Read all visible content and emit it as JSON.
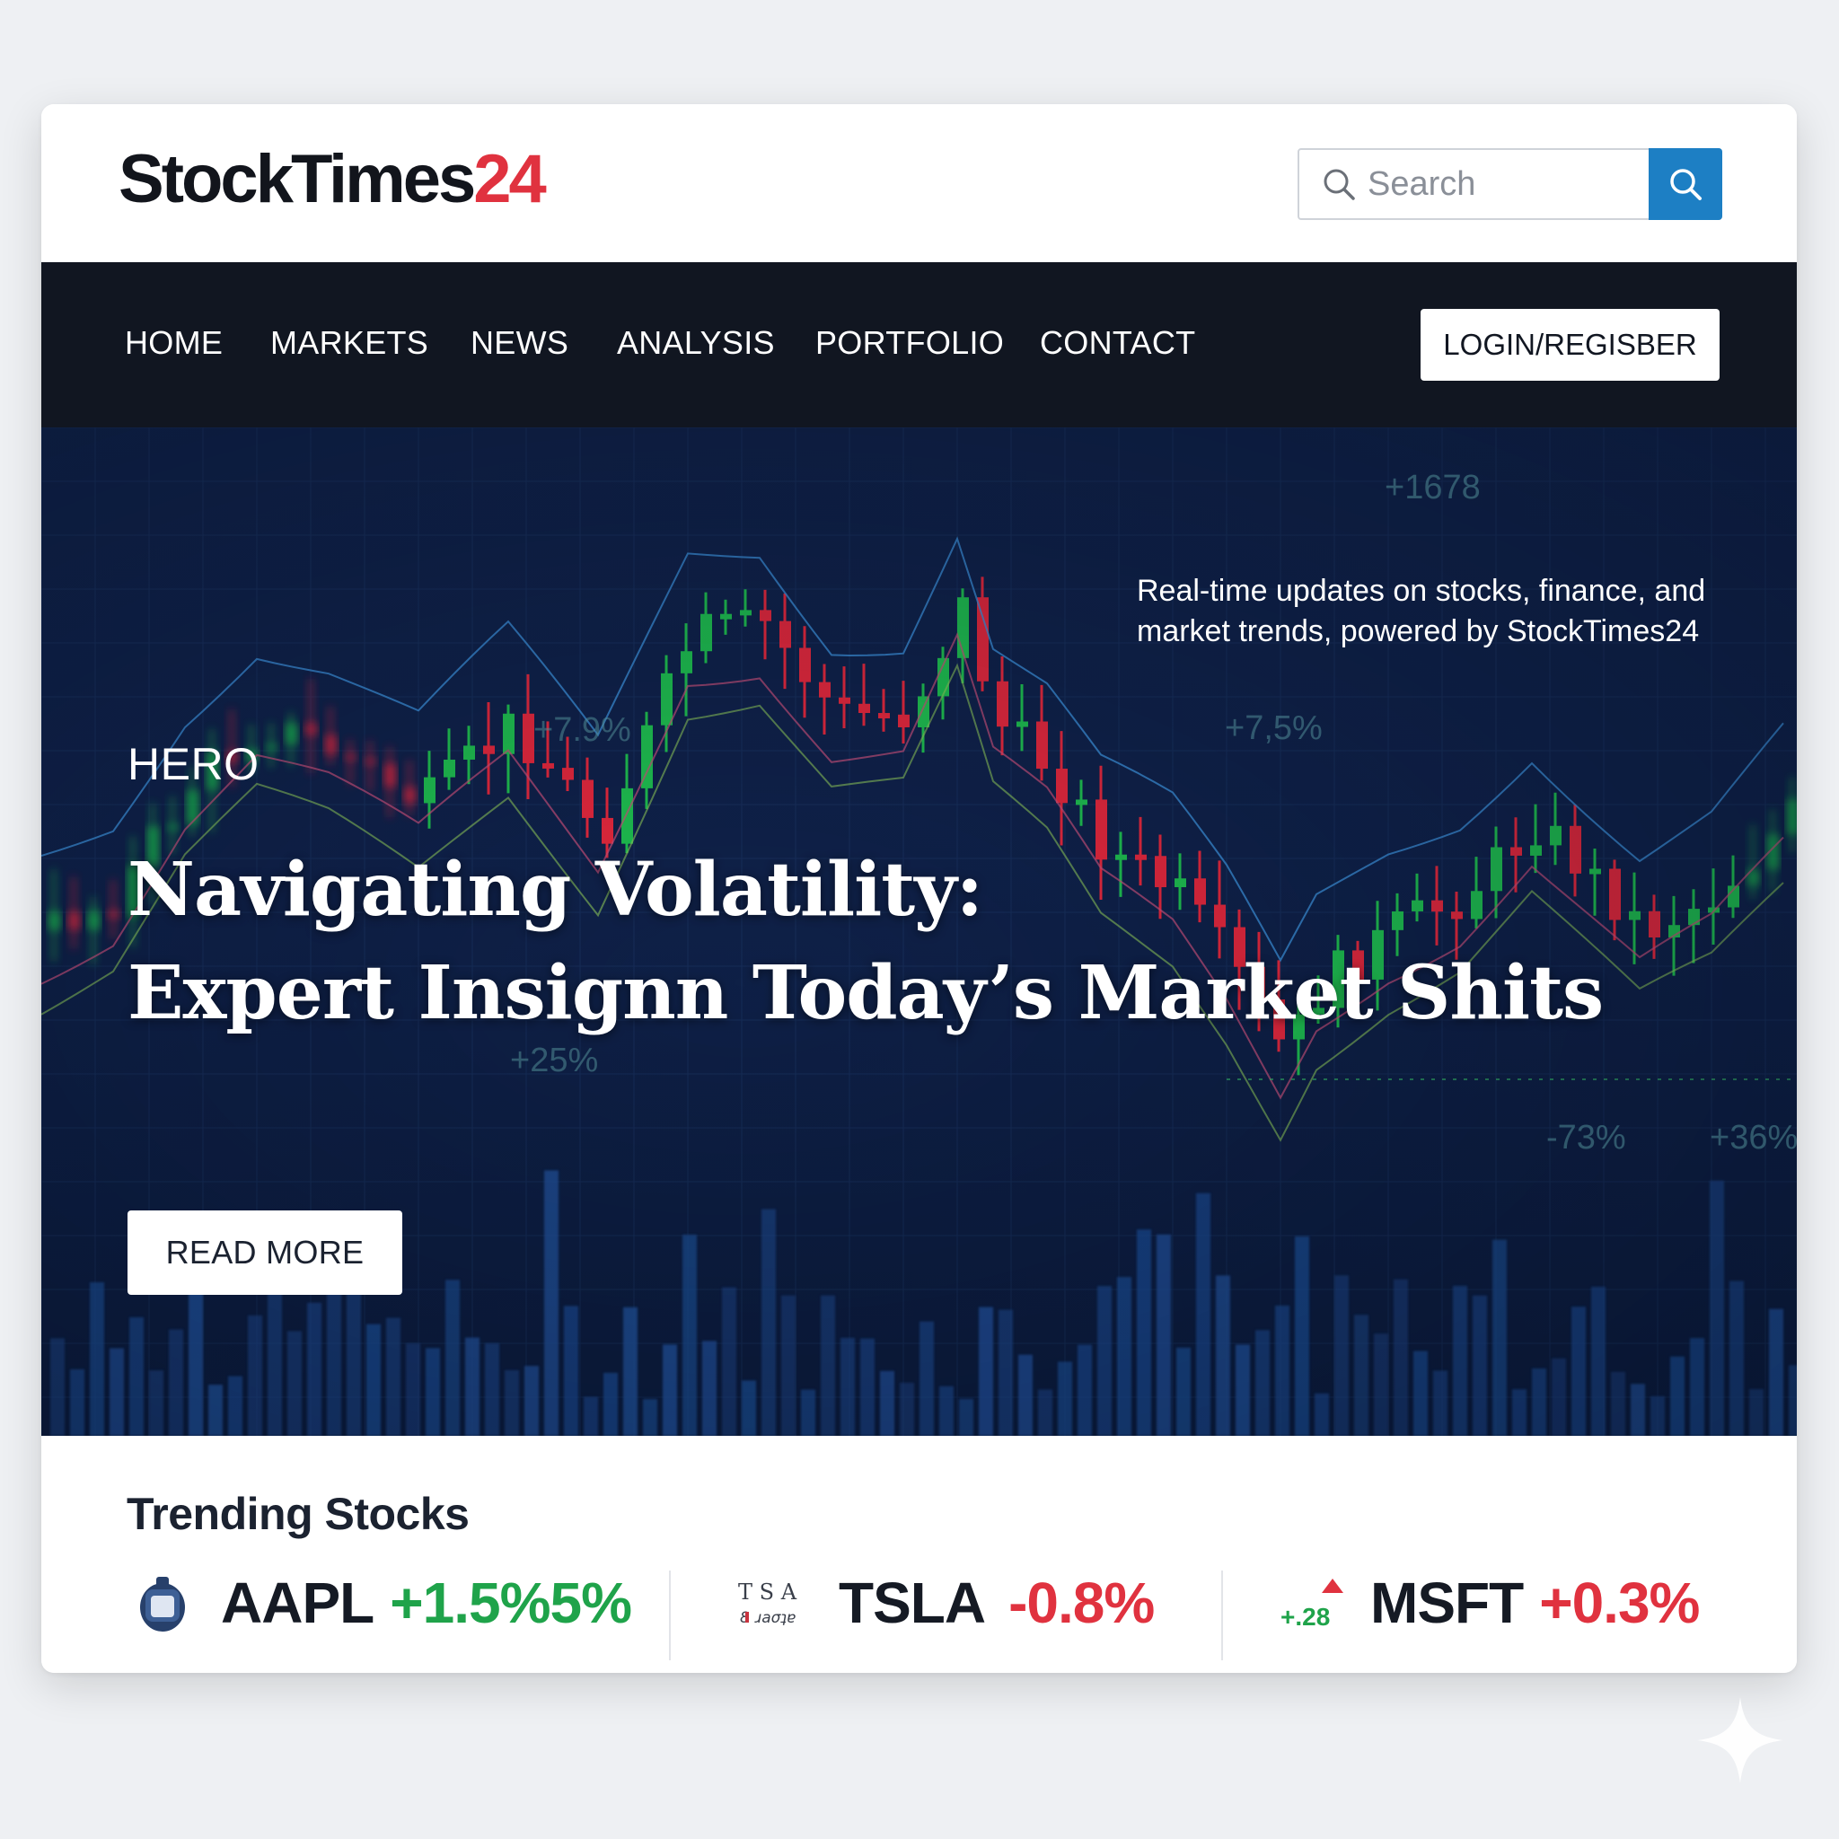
{
  "header": {
    "logo_main": "StockTimes",
    "logo_accent": "24",
    "search_placeholder": "Search"
  },
  "nav": {
    "items": [
      {
        "label": "HOME"
      },
      {
        "label": "MARKETS"
      },
      {
        "label": "NEWS"
      },
      {
        "label": "ANALYSIS"
      },
      {
        "label": "PORTFOLIO"
      },
      {
        "label": "CONTACT"
      }
    ],
    "login_label": "LOGIN/REGISBER"
  },
  "hero": {
    "tagline": "Real-time updates on stocks, finance, and market trends, powered by StockTimes24",
    "label": "HERO",
    "title_line1": "Navigating Volatility:",
    "title_line2": "Expert Insignn Today’s Market Shits",
    "cta_label": "READ MORE",
    "overlay_values": [
      "+1678",
      "+7.9%",
      "+7,5%",
      "-73%",
      "+25%",
      "+36%"
    ]
  },
  "trending": {
    "title": "Trending Stocks",
    "stocks": [
      {
        "ticker": "AAPL",
        "change": "+1.5%5%",
        "direction": "up",
        "icon": "apple-icon"
      },
      {
        "ticker": "TSLA",
        "change": "-0.8%",
        "direction": "down",
        "icon": "tesla-logo-icon"
      },
      {
        "ticker": "MSFT",
        "change": "+0.3%",
        "direction": "down",
        "icon": "msft-logo-icon",
        "icon_text": "+.28"
      }
    ]
  },
  "colors": {
    "brand_dark": "#12151c",
    "brand_accent": "#e0323f",
    "search_button": "#1d7fc4",
    "nav_bg": "#111621",
    "hero_bg": "#10224a",
    "up": "#1fa34a",
    "down": "#e0323f"
  }
}
